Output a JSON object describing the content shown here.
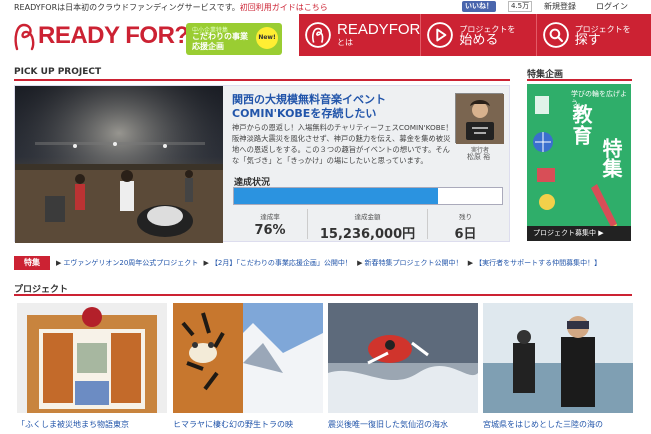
{
  "topbar": {
    "tagline": "READYFOR",
    "tagline_rest": "は日本初のクラウドファンディングサービスです。",
    "tagline_link": "初回利用ガイドはこちら",
    "fb_like": "いいね！",
    "fb_count": "4.5万",
    "register": "新規登録",
    "login": "ログイン"
  },
  "header": {
    "logo_text": "READY FOR?",
    "promo_small": "中小企業特集",
    "promo_big": "こだわりの事業応援企画",
    "promo_badge": "New!",
    "nav": [
      {
        "brand": "READY",
        "sub": "FOR",
        "rest": "とは"
      },
      {
        "small": "プロジェクトを",
        "big": "始める"
      },
      {
        "small": "プロジェクトを",
        "big": "探す"
      }
    ]
  },
  "pickup": {
    "section_title": "PICK UP PROJECT",
    "title": "関西の大規模無料音楽イベントCOMIN'KOBEを存続したい",
    "description": "神戸からの恩返し！入場無料のチャリティーフェスCOMIN'KOBE！阪神淡路大震災を風化させず、神戸の魅力を伝え、募金を集め被災地への恩返しをする。この３つの趣旨がイベントの想いです。そんな「気づき」と「きっかけ」の場にしたいと思っています。",
    "executor_label": "実行者",
    "executor_name": "松原 裕",
    "status_label": "達成状況",
    "progress": 0.76,
    "stats": [
      {
        "label": "達成率",
        "value": "76%"
      },
      {
        "label": "達成金額",
        "value": "15,236,000円"
      },
      {
        "label": "残り",
        "value": "6日"
      }
    ]
  },
  "feature": {
    "section_title": "特集企画",
    "line1": "学びの輪を広げよう。",
    "line2": "教育",
    "line3": "特集",
    "cta": "プロジェクト募集中 ▶"
  },
  "ticker": {
    "tag": "特集",
    "items": [
      "エヴァンゲリオン20周年公式プロジェクト",
      "【2月】「こだわりの事業応援企画」公開中！",
      "新春特集プロジェクト公開中！",
      "【実行者をサポートする仲間募集中！】"
    ]
  },
  "projects": {
    "section_title": "プロジェクト",
    "cards": [
      {
        "title": "「ふくしま被災地まち物語東京"
      },
      {
        "title": "ヒマラヤに棲む幻の野生トラの映"
      },
      {
        "title": "震災後唯一復旧した気仙沼の海水"
      },
      {
        "title": "宮城県をはじめとした三陸の海の"
      }
    ]
  }
}
